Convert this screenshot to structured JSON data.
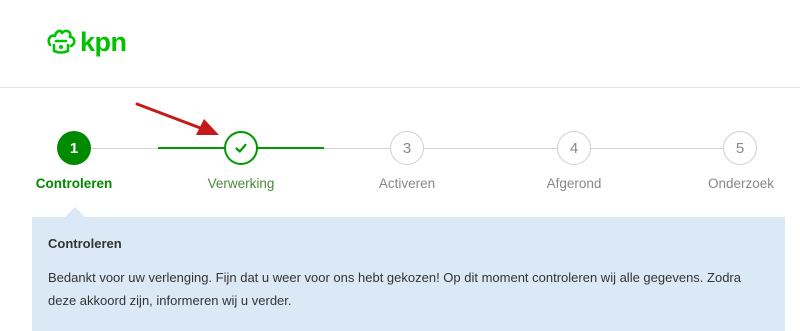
{
  "brand": {
    "logo_text": "kpn",
    "color": "#00c300"
  },
  "colors": {
    "active": "#008a00",
    "done_line": "#009900",
    "inactive": "#cfcfcf",
    "panel_bg": "#dbe9f6",
    "annotation_arrow": "#c41a1a"
  },
  "steps": [
    {
      "number": "1",
      "label": "Controleren",
      "state": "active"
    },
    {
      "number": "",
      "label": "Verwerking",
      "state": "done",
      "icon": "check-icon"
    },
    {
      "number": "3",
      "label": "Activeren",
      "state": "pending"
    },
    {
      "number": "4",
      "label": "Afgerond",
      "state": "pending"
    },
    {
      "number": "5",
      "label": "Onderzoek",
      "state": "pending"
    }
  ],
  "info": {
    "title": "Controleren",
    "body": "Bedankt voor uw verlenging. Fijn dat u weer voor ons hebt gekozen! Op dit moment controleren wij alle gegevens. Zodra deze akkoord zijn, informeren wij u verder."
  }
}
